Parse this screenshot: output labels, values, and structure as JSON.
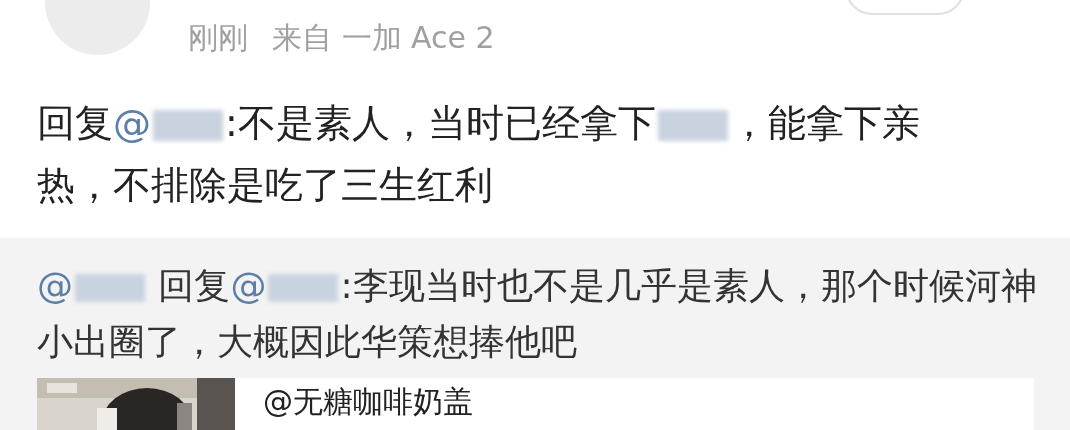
{
  "header": {
    "time": "刚刚",
    "source": "来自 一加 Ace 2"
  },
  "comment": {
    "segments": [
      {
        "kind": "text",
        "text": "回复"
      },
      {
        "kind": "mention",
        "text": "@"
      },
      {
        "kind": "redacted"
      },
      {
        "kind": "text",
        "text": ":不是素人，当时已经拿下"
      },
      {
        "kind": "redacted"
      },
      {
        "kind": "text",
        "text": "，能拿下亲热，不排除是吃了三生红利"
      }
    ]
  },
  "quoted": {
    "segments": [
      {
        "kind": "mention",
        "text": "@"
      },
      {
        "kind": "redacted"
      },
      {
        "kind": "text",
        "text": " 回复"
      },
      {
        "kind": "mention",
        "text": "@"
      },
      {
        "kind": "redacted"
      },
      {
        "kind": "text",
        "text": ":李现当时也不是几乎是素人，那个时候河神小出圈了，大概因此华策想捧他吧"
      }
    ],
    "card": {
      "title": "@无糖咖啡奶盖"
    }
  }
}
